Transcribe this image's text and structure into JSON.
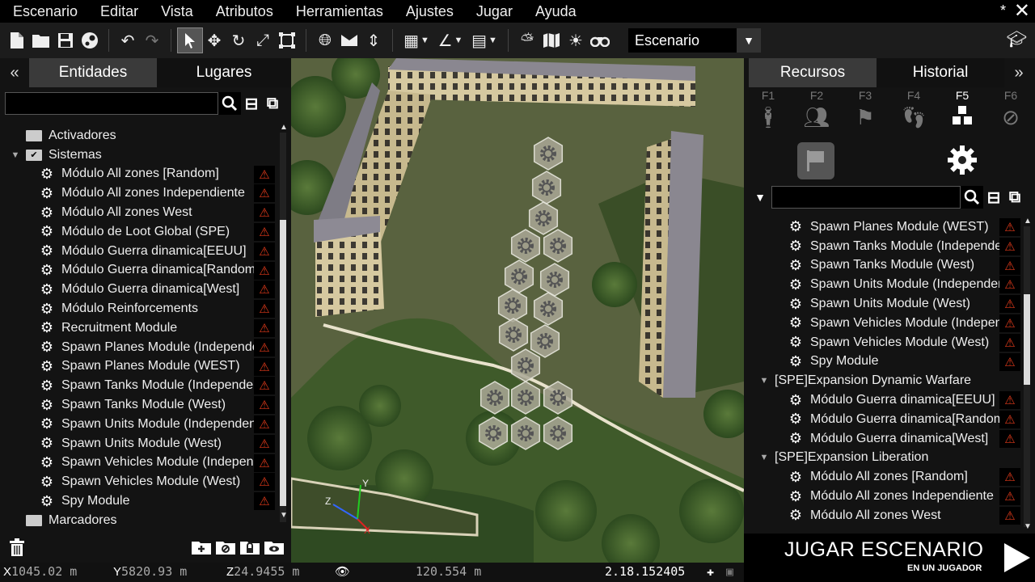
{
  "menu": [
    "Escenario",
    "Editar",
    "Vista",
    "Atributos",
    "Herramientas",
    "Ajustes",
    "Jugar",
    "Ayuda"
  ],
  "window": {
    "modified_mark": "*",
    "close_glyph": "✕"
  },
  "toolbar": {
    "mode_value": "Escenario"
  },
  "left_panel": {
    "collapse_glyph": "«",
    "tabs": [
      "Entidades",
      "Lugares"
    ],
    "search_placeholder": "",
    "tree": [
      {
        "kind": "category",
        "label": "Activadores"
      },
      {
        "kind": "group",
        "label": "Sistemas"
      },
      {
        "kind": "item",
        "label": "Módulo All zones [Random]"
      },
      {
        "kind": "item",
        "label": "Módulo All zones Independiente"
      },
      {
        "kind": "item",
        "label": "Módulo All zones West"
      },
      {
        "kind": "item",
        "label": "Módulo de Loot Global (SPE)"
      },
      {
        "kind": "item",
        "label": "Módulo Guerra dinamica[EEUU]"
      },
      {
        "kind": "item",
        "label": "Módulo Guerra dinamica[Random]"
      },
      {
        "kind": "item",
        "label": "Módulo Guerra dinamica[West]"
      },
      {
        "kind": "item",
        "label": "Módulo Reinforcements"
      },
      {
        "kind": "item",
        "label": "Recruitment Module"
      },
      {
        "kind": "item",
        "label": "Spawn Planes Module (Independent"
      },
      {
        "kind": "item",
        "label": "Spawn Planes Module (WEST)"
      },
      {
        "kind": "item",
        "label": "Spawn Tanks Module (Independent)"
      },
      {
        "kind": "item",
        "label": "Spawn Tanks Module (West)"
      },
      {
        "kind": "item",
        "label": "Spawn Units Module (Independent)"
      },
      {
        "kind": "item",
        "label": "Spawn Units Module (West)"
      },
      {
        "kind": "item",
        "label": "Spawn Vehicles Module (Independe"
      },
      {
        "kind": "item",
        "label": "Spawn Vehicles Module (West)"
      },
      {
        "kind": "item",
        "label": "Spy Module"
      },
      {
        "kind": "category",
        "label": "Marcadores"
      }
    ]
  },
  "right_panel": {
    "tabs": [
      "Recursos",
      "Historial"
    ],
    "collapse_glyph": "»",
    "fkeys": [
      "F1",
      "F2",
      "F3",
      "F4",
      "F5",
      "F6"
    ],
    "search_placeholder": "",
    "tree": [
      {
        "kind": "item",
        "label": "Spawn Planes Module (WEST)"
      },
      {
        "kind": "item",
        "label": "Spawn Tanks Module (Independent)"
      },
      {
        "kind": "item",
        "label": "Spawn Tanks Module (West)"
      },
      {
        "kind": "item",
        "label": "Spawn Units Module (Independent)"
      },
      {
        "kind": "item",
        "label": "Spawn Units Module (West)"
      },
      {
        "kind": "item",
        "label": "Spawn Vehicles Module (Independe"
      },
      {
        "kind": "item",
        "label": "Spawn Vehicles Module (West)"
      },
      {
        "kind": "item",
        "label": "Spy Module"
      },
      {
        "kind": "group",
        "label": "[SPE]Expansion Dynamic Warfare"
      },
      {
        "kind": "item",
        "label": "Módulo Guerra dinamica[EEUU]"
      },
      {
        "kind": "item",
        "label": "Módulo Guerra dinamica[Random]"
      },
      {
        "kind": "item",
        "label": "Módulo Guerra dinamica[West]"
      },
      {
        "kind": "group",
        "label": "[SPE]Expansion Liberation"
      },
      {
        "kind": "item",
        "label": "Módulo All zones [Random]"
      },
      {
        "kind": "item",
        "label": "Módulo All zones Independiente"
      },
      {
        "kind": "item",
        "label": "Módulo All zones West"
      }
    ]
  },
  "viewport": {
    "axis_x": "X",
    "axis_y": "Y",
    "axis_z": "Z"
  },
  "status": {
    "x_label": "X",
    "x_value": "1045.02 m",
    "y_label": "Y",
    "y_value": "5820.93 m",
    "z_label": "Z",
    "z_value": "24.9455 m",
    "view_distance": "120.554 m",
    "version": "2.18.152405"
  },
  "play": {
    "title": "JUGAR ESCENARIO",
    "subtitle": "EN UN JUGADOR"
  }
}
